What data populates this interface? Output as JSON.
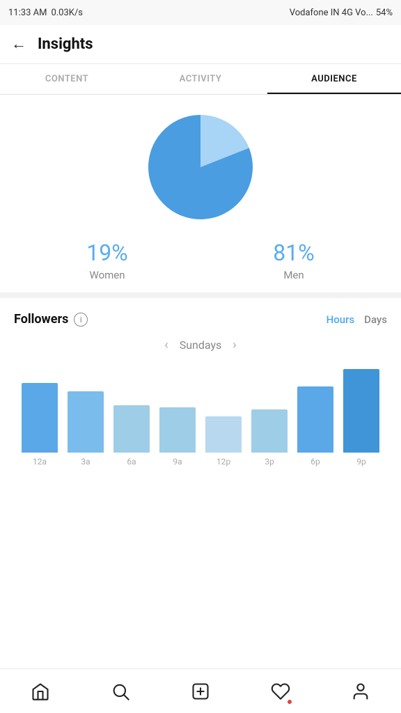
{
  "statusBar": {
    "time": "11:33 AM",
    "network": "0.03K/s",
    "carrier": "Vodafone IN 4G Vo...",
    "battery": "54%"
  },
  "header": {
    "title": "Insights",
    "backLabel": "←"
  },
  "tabs": [
    {
      "id": "content",
      "label": "CONTENT"
    },
    {
      "id": "activity",
      "label": "ACTIVITY"
    },
    {
      "id": "audience",
      "label": "AUDIENCE"
    }
  ],
  "activeTab": "audience",
  "genderStats": {
    "women": {
      "percent": "19%",
      "label": "Women"
    },
    "men": {
      "percent": "81%",
      "label": "Men"
    }
  },
  "followersSection": {
    "title": "Followers",
    "timeButtons": [
      {
        "id": "hours",
        "label": "Hours",
        "active": true
      },
      {
        "id": "days",
        "label": "Days",
        "active": false
      }
    ],
    "dayNav": {
      "prev": "‹",
      "label": "Sundays",
      "next": "›"
    },
    "barChart": {
      "bars": [
        {
          "label": "12a",
          "heightPx": 100,
          "color": "#5aa8e8"
        },
        {
          "label": "3a",
          "heightPx": 88,
          "color": "#7abcec"
        },
        {
          "label": "6a",
          "heightPx": 68,
          "color": "#9ecde8"
        },
        {
          "label": "9a",
          "heightPx": 65,
          "color": "#9ecde8"
        },
        {
          "label": "12p",
          "heightPx": 52,
          "color": "#b8d8f0"
        },
        {
          "label": "3p",
          "heightPx": 62,
          "color": "#9ecde8"
        },
        {
          "label": "6p",
          "heightPx": 95,
          "color": "#5aa8e8"
        },
        {
          "label": "9p",
          "heightPx": 120,
          "color": "#4095d8"
        }
      ]
    }
  },
  "bottomNav": {
    "items": [
      {
        "id": "home",
        "icon": "home"
      },
      {
        "id": "search",
        "icon": "search"
      },
      {
        "id": "add",
        "icon": "plus-square"
      },
      {
        "id": "heart",
        "icon": "heart",
        "dot": true
      },
      {
        "id": "profile",
        "icon": "person"
      }
    ]
  },
  "pie": {
    "womenPercent": 19,
    "menPercent": 81,
    "womenColor": "#a8d4f5",
    "menColor": "#4a9de0"
  }
}
